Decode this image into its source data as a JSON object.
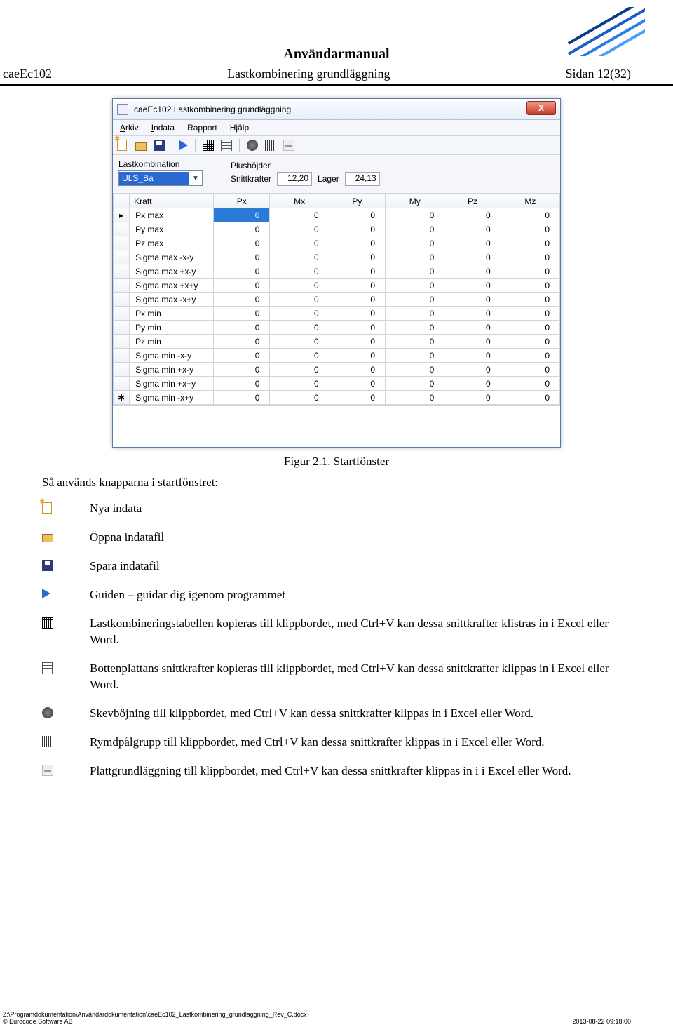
{
  "header": {
    "title": "Användarmanual",
    "left": "caeEc102",
    "center": "Lastkombinering grundläggning",
    "right": "Sidan 12(32)"
  },
  "window": {
    "title": "caeEc102 Lastkombinering grundläggning",
    "close_glyph": "X",
    "menus": {
      "arkiv": "Arkiv",
      "indata": "Indata",
      "rapport": "Rapport",
      "hjalp": "Hjälp"
    },
    "panel": {
      "lastkomb_label": "Lastkombination",
      "lastkomb_value": "ULS_Ba",
      "plus_label": "Plushöjder",
      "snitt_label": "Snittkrafter",
      "snitt_value": "12,20",
      "lager_label": "Lager",
      "lager_value": "24,13"
    },
    "columns": [
      "Kraft",
      "Px",
      "Mx",
      "Py",
      "My",
      "Pz",
      "Mz"
    ],
    "rows": [
      {
        "mark": "▸",
        "name": "Px max",
        "vals": [
          "0",
          "0",
          "0",
          "0",
          "0",
          "0"
        ],
        "sel": true
      },
      {
        "mark": "",
        "name": "Py max",
        "vals": [
          "0",
          "0",
          "0",
          "0",
          "0",
          "0"
        ]
      },
      {
        "mark": "",
        "name": "Pz max",
        "vals": [
          "0",
          "0",
          "0",
          "0",
          "0",
          "0"
        ]
      },
      {
        "mark": "",
        "name": "Sigma max -x-y",
        "vals": [
          "0",
          "0",
          "0",
          "0",
          "0",
          "0"
        ]
      },
      {
        "mark": "",
        "name": "Sigma max +x-y",
        "vals": [
          "0",
          "0",
          "0",
          "0",
          "0",
          "0"
        ]
      },
      {
        "mark": "",
        "name": "Sigma max +x+y",
        "vals": [
          "0",
          "0",
          "0",
          "0",
          "0",
          "0"
        ]
      },
      {
        "mark": "",
        "name": "Sigma max -x+y",
        "vals": [
          "0",
          "0",
          "0",
          "0",
          "0",
          "0"
        ]
      },
      {
        "mark": "",
        "name": "Px min",
        "vals": [
          "0",
          "0",
          "0",
          "0",
          "0",
          "0"
        ]
      },
      {
        "mark": "",
        "name": "Py min",
        "vals": [
          "0",
          "0",
          "0",
          "0",
          "0",
          "0"
        ]
      },
      {
        "mark": "",
        "name": "Pz min",
        "vals": [
          "0",
          "0",
          "0",
          "0",
          "0",
          "0"
        ]
      },
      {
        "mark": "",
        "name": "Sigma min -x-y",
        "vals": [
          "0",
          "0",
          "0",
          "0",
          "0",
          "0"
        ]
      },
      {
        "mark": "",
        "name": "Sigma min +x-y",
        "vals": [
          "0",
          "0",
          "0",
          "0",
          "0",
          "0"
        ]
      },
      {
        "mark": "",
        "name": "Sigma min +x+y",
        "vals": [
          "0",
          "0",
          "0",
          "0",
          "0",
          "0"
        ]
      },
      {
        "mark": "✱",
        "name": "Sigma min -x+y",
        "vals": [
          "0",
          "0",
          "0",
          "0",
          "0",
          "0"
        ]
      }
    ]
  },
  "caption": "Figur 2.1. Startfönster",
  "intro": "Så används knapparna i startfönstret:",
  "iconlist": [
    {
      "icon": "newdoc",
      "text": "Nya indata"
    },
    {
      "icon": "open",
      "text": "Öppna indatafil"
    },
    {
      "icon": "save",
      "text": "Spara indatafil"
    },
    {
      "icon": "play",
      "text": "Guiden – guidar dig igenom programmet"
    },
    {
      "icon": "grid1",
      "text": "Lastkombineringstabellen kopieras till klippbordet, med Ctrl+V kan dessa snittkrafter klistras in i Excel eller Word."
    },
    {
      "icon": "grid2",
      "text": "Bottenplattans snittkrafter kopieras till klippbordet, med Ctrl+V kan dessa snittkrafter klippas in i Excel eller Word."
    },
    {
      "icon": "dot",
      "text": "Skevböjning till klippbordet, med Ctrl+V kan dessa snittkrafter klippas in i Excel eller Word."
    },
    {
      "icon": "hatch",
      "text": "Rymdpålgrupp till klippbordet, med Ctrl+V kan dessa snittkrafter klippas in i Excel eller Word."
    },
    {
      "icon": "plate",
      "text": "Plattgrundläggning till klippbordet, med Ctrl+V kan dessa snittkrafter klippas in i i Excel eller Word."
    }
  ],
  "footer": {
    "path": "Z:\\Programdokumentation\\Användardokumentation\\caeEc102_Lastkombinering_grundlaggning_Rev_C.docx",
    "copyright": "© Eurocode Software AB",
    "date": "2013-08-22 09:18:00"
  }
}
